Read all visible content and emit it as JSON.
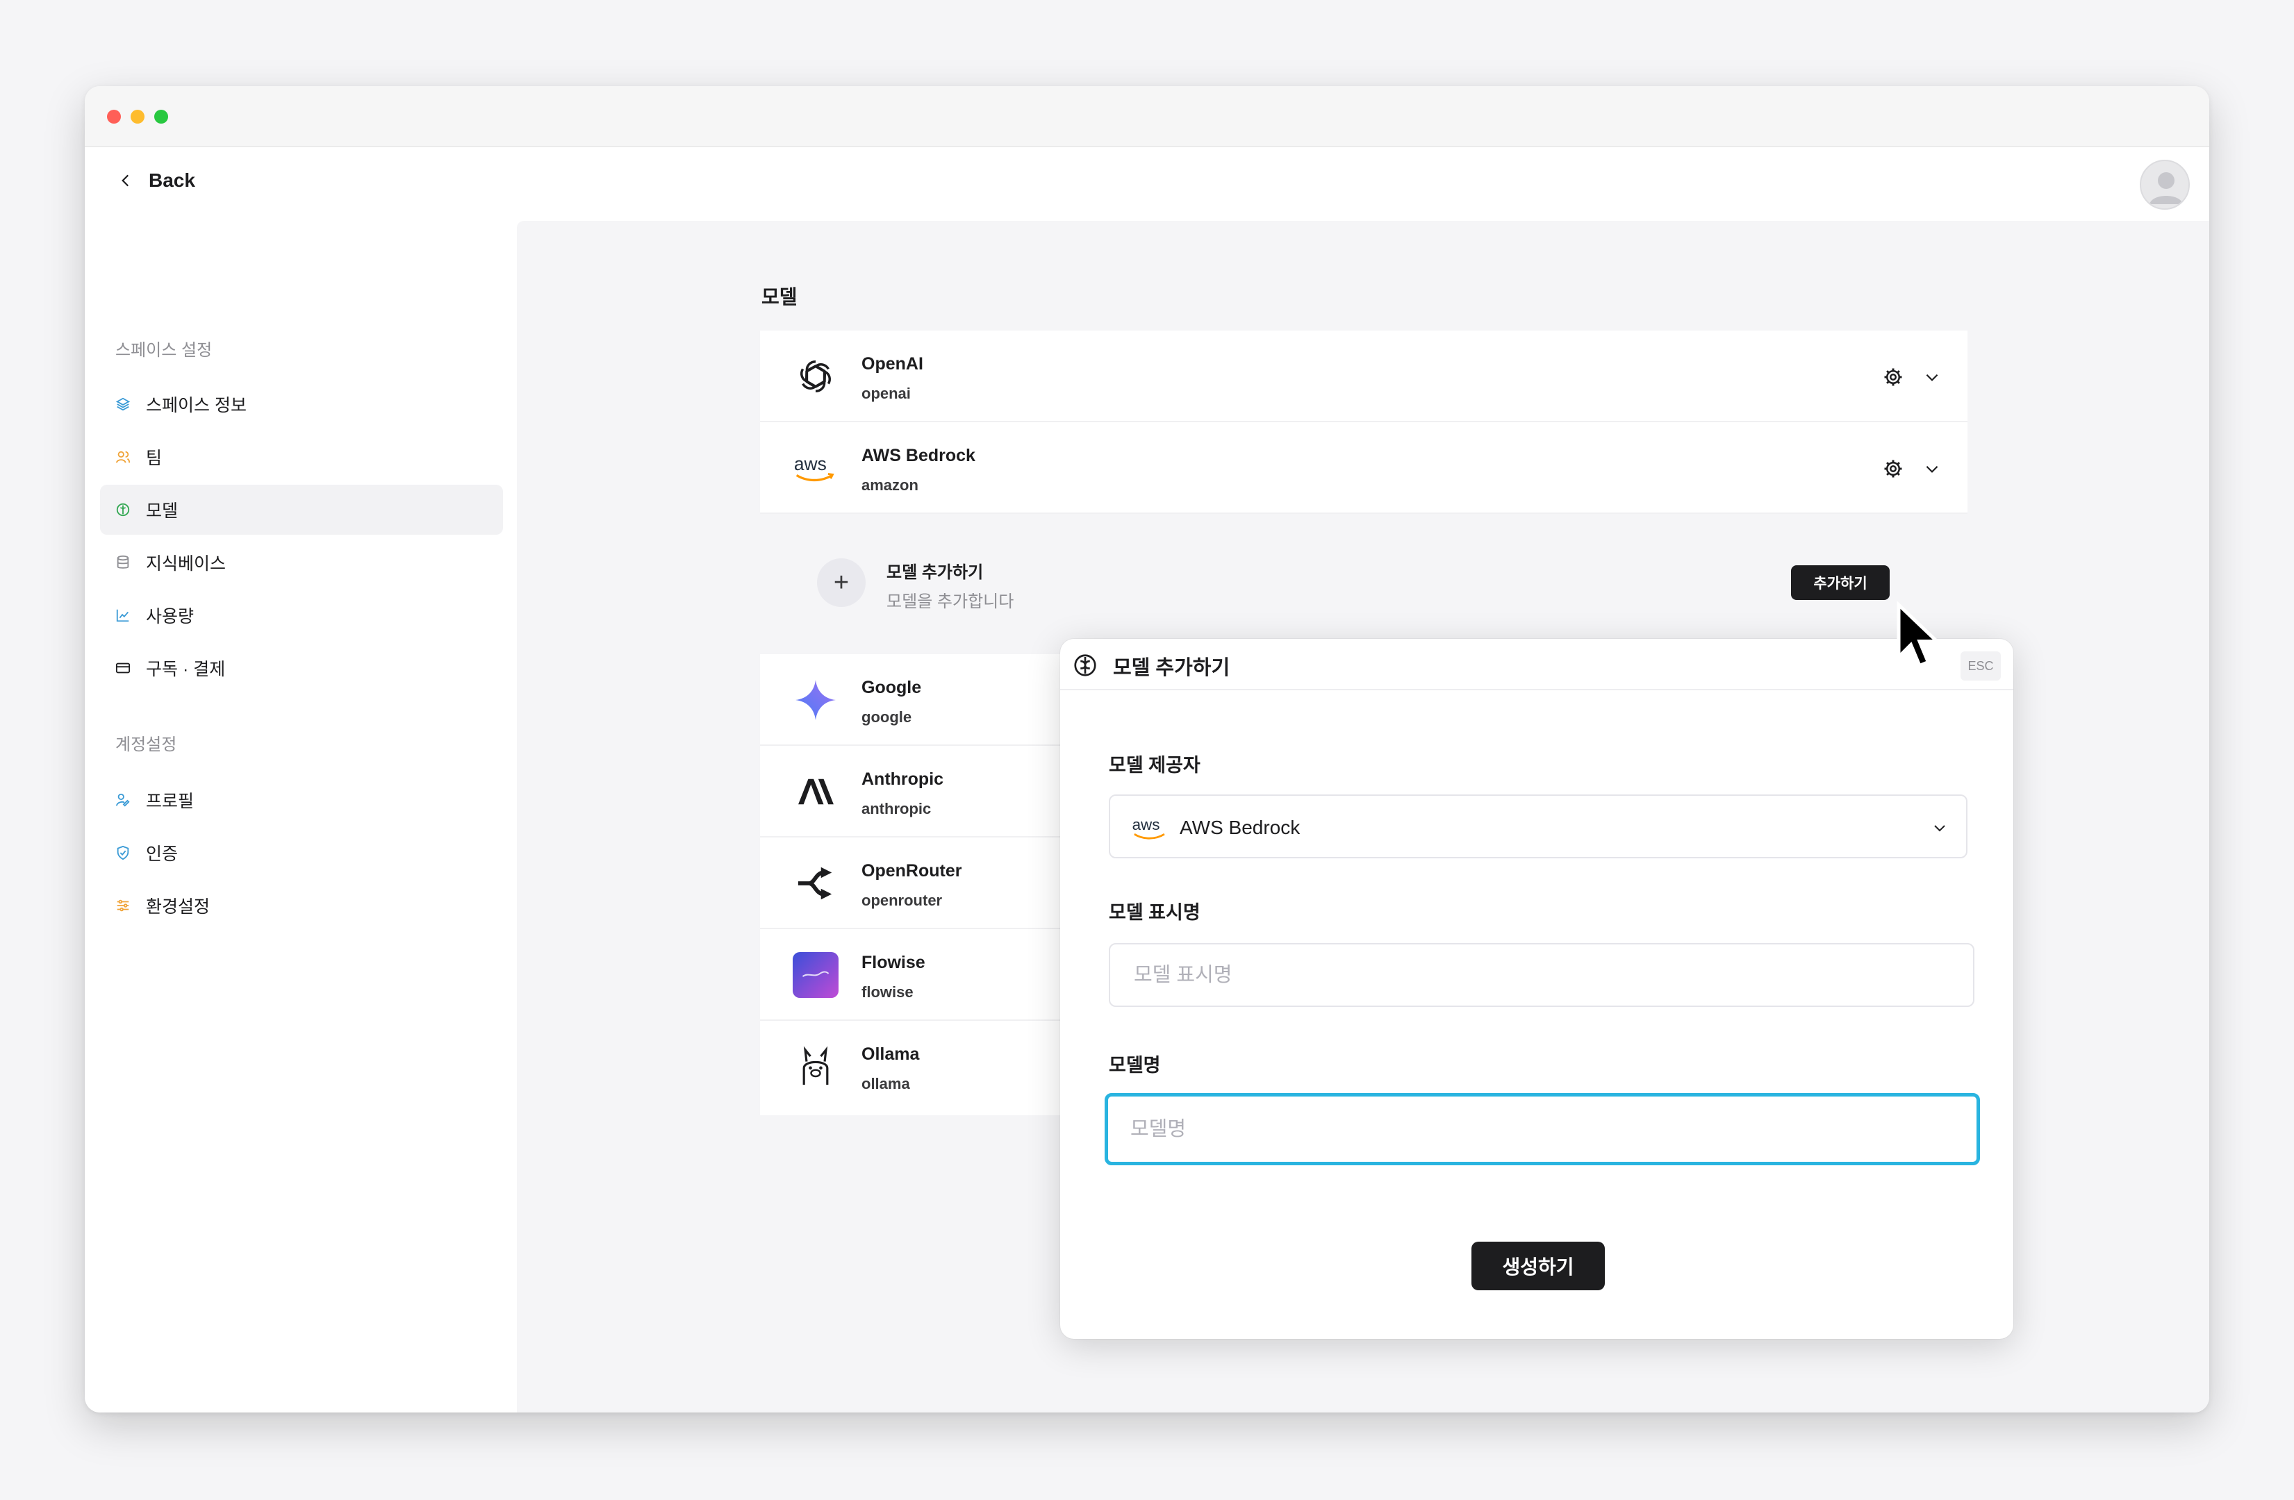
{
  "nav": {
    "back_label": "Back"
  },
  "sidebar": {
    "space_heading": "스페이스 설정",
    "space_items": [
      {
        "label": "스페이스 정보",
        "icon": "layers-icon"
      },
      {
        "label": "팀",
        "icon": "users-icon"
      },
      {
        "label": "모델",
        "icon": "brain-icon",
        "active": true
      },
      {
        "label": "지식베이스",
        "icon": "database-icon"
      },
      {
        "label": "사용량",
        "icon": "chart-icon"
      },
      {
        "label": "구독 · 결제",
        "icon": "card-icon"
      }
    ],
    "account_heading": "계정설정",
    "account_items": [
      {
        "label": "프로필",
        "icon": "user-edit-icon"
      },
      {
        "label": "인증",
        "icon": "shield-icon"
      },
      {
        "label": "환경설정",
        "icon": "settings-list-icon"
      }
    ]
  },
  "main": {
    "title": "모델",
    "providers": [
      {
        "name": "OpenAI",
        "id": "openai",
        "icon": "openai-logo"
      },
      {
        "name": "AWS Bedrock",
        "id": "amazon",
        "icon": "aws-logo"
      }
    ],
    "add_row": {
      "title": "모델 추가하기",
      "subtitle": "모델을 추가합니다",
      "button": "추가하기"
    },
    "more_providers": [
      {
        "name": "Google",
        "id": "google",
        "icon": "gemini-logo"
      },
      {
        "name": "Anthropic",
        "id": "anthropic",
        "icon": "anthropic-logo"
      },
      {
        "name": "OpenRouter",
        "id": "openrouter",
        "icon": "openrouter-logo"
      },
      {
        "name": "Flowise",
        "id": "flowise",
        "icon": "flowise-logo"
      },
      {
        "name": "Ollama",
        "id": "ollama",
        "icon": "ollama-logo"
      }
    ]
  },
  "modal": {
    "title": "모델 추가하기",
    "esc_label": "ESC",
    "provider_label": "모델 제공자",
    "provider_value": "AWS Bedrock",
    "display_name_label": "모델 표시명",
    "display_name_placeholder": "모델 표시명",
    "model_name_label": "모델명",
    "model_name_placeholder": "모델명",
    "submit_label": "생성하기"
  },
  "colors": {
    "focus": "#29b4e0",
    "accent_dark": "#1d1d1f",
    "aws_orange": "#ff9900"
  }
}
